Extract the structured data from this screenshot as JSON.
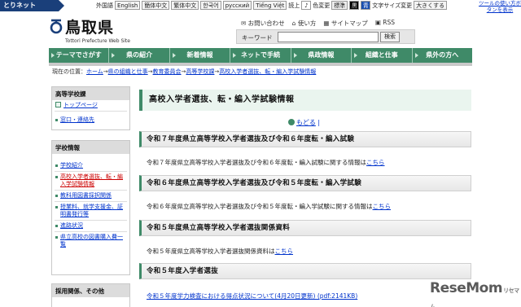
{
  "topbar": {
    "brand": "とりネット",
    "foreign_label": "外国語",
    "languages": [
      "English",
      "簡体中文",
      "繁体中文",
      "한국어",
      "русский",
      "Tiếng Việt"
    ],
    "ruby": "読上",
    "color_label": "色変更",
    "color_std": "標準",
    "color_black": "黒",
    "color_blue": "青",
    "text_size_label": "文字サイズ変更",
    "text_size_large": "大きくする",
    "tool_nav": "ツールの使い方ボタンを表示"
  },
  "header": {
    "site_name": "鳥取県",
    "site_sub": "Tottori Prefecture Web Site",
    "links": [
      "お問い合わせ",
      "使い方",
      "サイトマップ",
      "RSS"
    ],
    "search_label": "キーワード",
    "search_value": "",
    "search_button": "検索"
  },
  "nav": {
    "items": [
      "テーマでさがす",
      "県の紹介",
      "新着情報",
      "ネットで手続",
      "県政情報",
      "組織と仕事",
      "県外の方へ"
    ]
  },
  "breadcrumb": {
    "prefix": "現在の位置：",
    "items": [
      "ホーム",
      "県の組織と仕事",
      "教育委員会",
      "高等学校課",
      "高校入学者選抜、転・編入学試験情報"
    ]
  },
  "sidebar": {
    "box1": {
      "title": "高等学校課",
      "top": "トップページ",
      "contact": "窓口・連絡先"
    },
    "box2": {
      "title": "学校情報",
      "items": [
        "学校紹介",
        "高校入学者選抜、転・編入学試験情報",
        "教科用図書採択関係",
        "授業料、就学支援金、証明書発行等",
        "進路状況",
        "県立高校の図書購入費一覧"
      ]
    },
    "box3": {
      "title": "採用関係、その他"
    }
  },
  "main": {
    "page_title": "高校入学者選抜、転・編入学試験情報",
    "back": "もどる",
    "sections": [
      {
        "heading": "令和７年度県立高等学校入学者選抜及び令和６年度転・編入試験",
        "text": "令和７年度県立高等学校入学者選抜及び令和６年度転・編入試験に関する情報は",
        "link": "こちら"
      },
      {
        "heading": "令和６年度県立高等学校入学者選抜及び令和５年度転・編入学試験",
        "text": "令和６年度県立高等学校入学者選抜及び令和５年度転・編入学試験に関する情報は",
        "link": "こちら"
      },
      {
        "heading": "令和５年度県立高等学校入学者選抜関係資料",
        "text": "令和５年度県立高等学校入学者選抜関係資料は",
        "link": "こちら"
      },
      {
        "heading": "令和５年度入学者選抜",
        "text": "",
        "link": "令和５年度学力検査における得点状況について(4月20日更新) (pdf:2141KB)"
      }
    ]
  },
  "watermark": {
    "main": "ReseMom",
    "sub": "リセマム"
  }
}
